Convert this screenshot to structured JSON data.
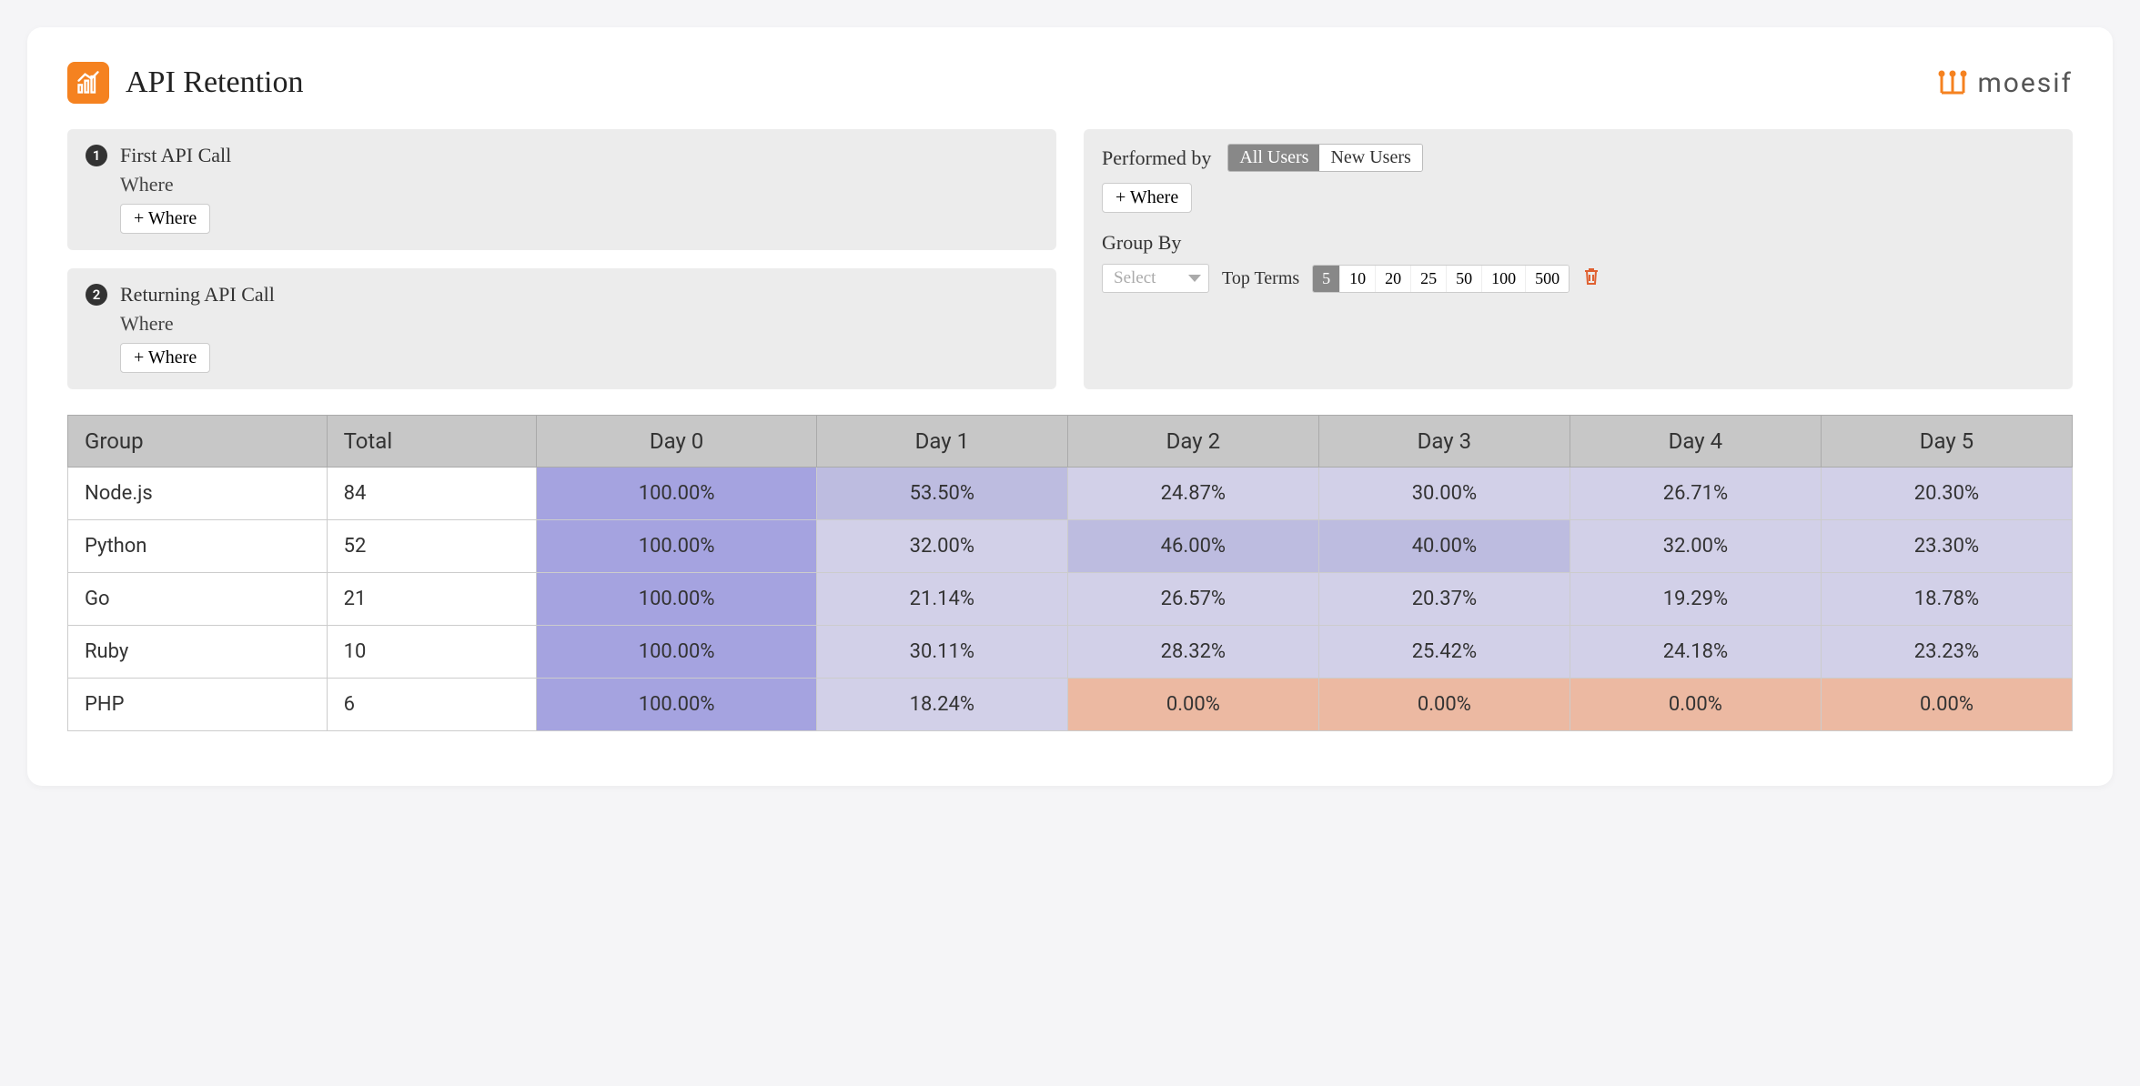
{
  "page_title": "API Retention",
  "brand": "moesif",
  "filters": {
    "first": {
      "badge": "1",
      "title": "First API Call",
      "where_label": "Where",
      "add_where_btn": "+ Where"
    },
    "returning": {
      "badge": "2",
      "title": "Returning API Call",
      "where_label": "Where",
      "add_where_btn": "+ Where"
    },
    "performed_by_label": "Performed by",
    "performed_by_options": [
      "All Users",
      "New Users"
    ],
    "performed_by_selected": "All Users",
    "add_where_btn": "+ Where",
    "group_by_label": "Group By",
    "select_placeholder": "Select",
    "top_terms_label": "Top Terms",
    "top_terms_options": [
      "5",
      "10",
      "20",
      "25",
      "50",
      "100",
      "500"
    ],
    "top_terms_selected": "5"
  },
  "chart_data": {
    "type": "table",
    "title": "API Retention",
    "columns": [
      "Group",
      "Total",
      "Day 0",
      "Day 1",
      "Day 2",
      "Day 3",
      "Day 4",
      "Day 5"
    ],
    "rows": [
      {
        "group": "Node.js",
        "total": 84,
        "values": [
          100.0,
          53.5,
          24.87,
          30.0,
          26.71,
          20.3
        ]
      },
      {
        "group": "Python",
        "total": 52,
        "values": [
          100.0,
          32.0,
          46.0,
          40.0,
          32.0,
          23.3
        ]
      },
      {
        "group": "Go",
        "total": 21,
        "values": [
          100.0,
          21.14,
          26.57,
          20.37,
          19.29,
          18.78
        ]
      },
      {
        "group": "Ruby",
        "total": 10,
        "values": [
          100.0,
          30.11,
          28.32,
          25.42,
          24.18,
          23.23
        ]
      },
      {
        "group": "PHP",
        "total": 6,
        "values": [
          100.0,
          18.24,
          0.0,
          0.0,
          0.0,
          0.0
        ]
      }
    ],
    "color_scale": {
      "zero": "#ecb9a2",
      "low": "#d2d0e8",
      "mid": "#bdbce0",
      "high": "#a5a3e0"
    }
  }
}
